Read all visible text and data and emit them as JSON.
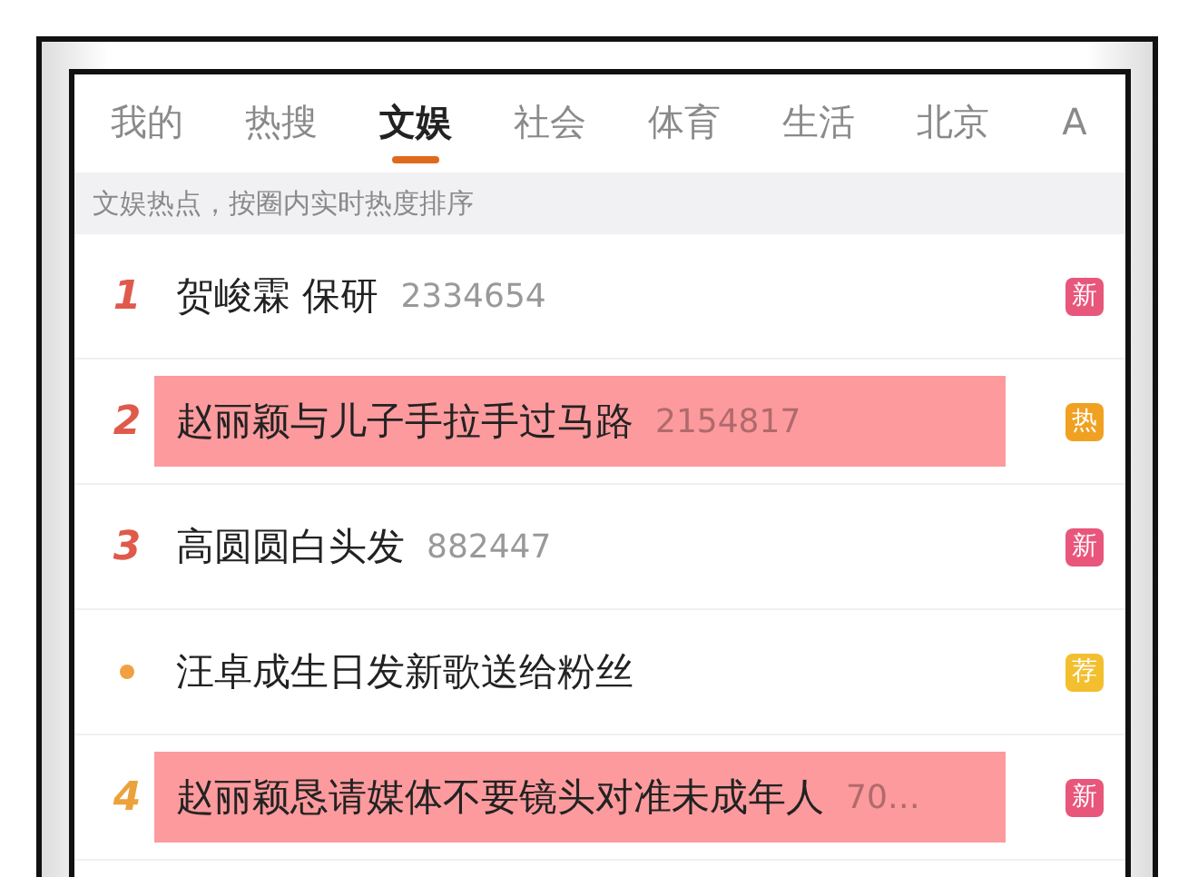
{
  "tabs": [
    {
      "label": "我的",
      "selected": false
    },
    {
      "label": "热搜",
      "selected": false
    },
    {
      "label": "文娱",
      "selected": true
    },
    {
      "label": "社会",
      "selected": false
    },
    {
      "label": "体育",
      "selected": false
    },
    {
      "label": "生活",
      "selected": false
    },
    {
      "label": "北京",
      "selected": false
    },
    {
      "label": "A",
      "selected": false
    }
  ],
  "info_bar": "文娱热点，按圈内实时热度排序",
  "rows": [
    {
      "kind": "number",
      "rank": "1",
      "color": "#e05a4c",
      "title": "贺峻霖 保研",
      "count": "2334654",
      "badge": {
        "text": "新",
        "color": "#e8567c"
      },
      "highlighted": false
    },
    {
      "kind": "number",
      "rank": "2",
      "color": "#e05a4c",
      "title": "赵丽颖与儿子手拉手过马路",
      "count": "2154817",
      "badge": {
        "text": "热",
        "color": "#f0a122"
      },
      "highlighted": true
    },
    {
      "kind": "number",
      "rank": "3",
      "color": "#e05a4c",
      "title": "高圆圆白头发",
      "count": "882447",
      "badge": {
        "text": "新",
        "color": "#e8567c"
      },
      "highlighted": false
    },
    {
      "kind": "dot",
      "color": "#f0a040",
      "title": "汪卓成生日发新歌送给粉丝",
      "badge": {
        "text": "荐",
        "color": "#f3bf2e"
      },
      "highlighted": false
    },
    {
      "kind": "number",
      "rank": "4",
      "color": "#eca23a",
      "title": "赵丽颖恳请媒体不要镜头对准未成年人",
      "count": "70…",
      "badge": {
        "text": "新",
        "color": "#e8567c"
      },
      "highlighted": true
    }
  ]
}
